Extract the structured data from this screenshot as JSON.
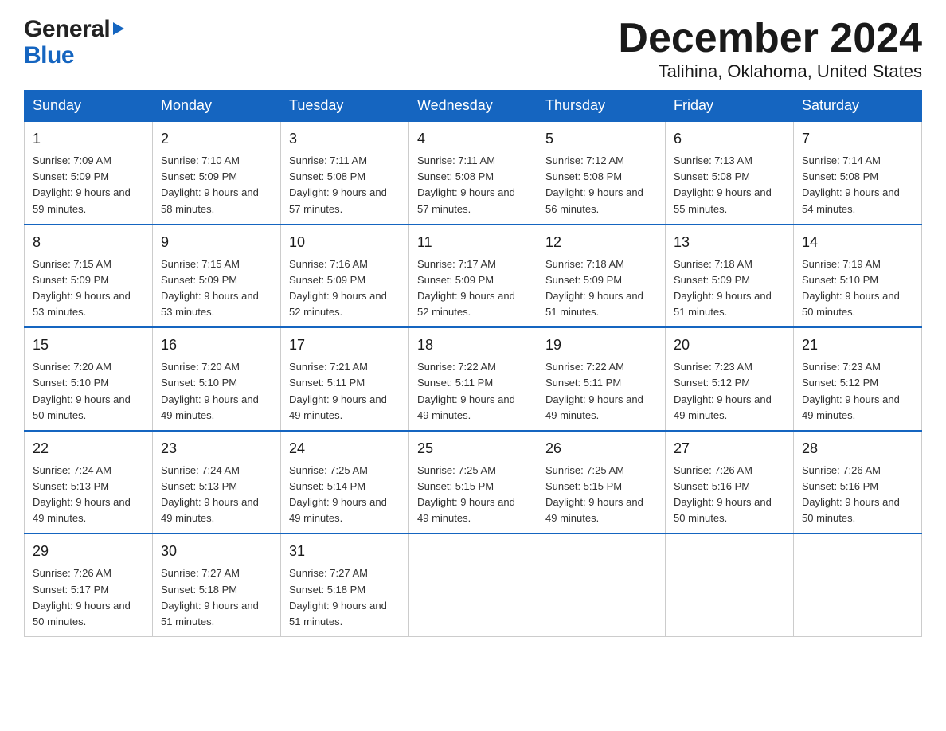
{
  "header": {
    "logo_general": "General",
    "logo_blue": "Blue",
    "month_title": "December 2024",
    "location": "Talihina, Oklahoma, United States"
  },
  "days_of_week": [
    "Sunday",
    "Monday",
    "Tuesday",
    "Wednesday",
    "Thursday",
    "Friday",
    "Saturday"
  ],
  "weeks": [
    [
      {
        "day": "1",
        "sunrise": "7:09 AM",
        "sunset": "5:09 PM",
        "daylight": "9 hours and 59 minutes."
      },
      {
        "day": "2",
        "sunrise": "7:10 AM",
        "sunset": "5:09 PM",
        "daylight": "9 hours and 58 minutes."
      },
      {
        "day": "3",
        "sunrise": "7:11 AM",
        "sunset": "5:08 PM",
        "daylight": "9 hours and 57 minutes."
      },
      {
        "day": "4",
        "sunrise": "7:11 AM",
        "sunset": "5:08 PM",
        "daylight": "9 hours and 57 minutes."
      },
      {
        "day": "5",
        "sunrise": "7:12 AM",
        "sunset": "5:08 PM",
        "daylight": "9 hours and 56 minutes."
      },
      {
        "day": "6",
        "sunrise": "7:13 AM",
        "sunset": "5:08 PM",
        "daylight": "9 hours and 55 minutes."
      },
      {
        "day": "7",
        "sunrise": "7:14 AM",
        "sunset": "5:08 PM",
        "daylight": "9 hours and 54 minutes."
      }
    ],
    [
      {
        "day": "8",
        "sunrise": "7:15 AM",
        "sunset": "5:09 PM",
        "daylight": "9 hours and 53 minutes."
      },
      {
        "day": "9",
        "sunrise": "7:15 AM",
        "sunset": "5:09 PM",
        "daylight": "9 hours and 53 minutes."
      },
      {
        "day": "10",
        "sunrise": "7:16 AM",
        "sunset": "5:09 PM",
        "daylight": "9 hours and 52 minutes."
      },
      {
        "day": "11",
        "sunrise": "7:17 AM",
        "sunset": "5:09 PM",
        "daylight": "9 hours and 52 minutes."
      },
      {
        "day": "12",
        "sunrise": "7:18 AM",
        "sunset": "5:09 PM",
        "daylight": "9 hours and 51 minutes."
      },
      {
        "day": "13",
        "sunrise": "7:18 AM",
        "sunset": "5:09 PM",
        "daylight": "9 hours and 51 minutes."
      },
      {
        "day": "14",
        "sunrise": "7:19 AM",
        "sunset": "5:10 PM",
        "daylight": "9 hours and 50 minutes."
      }
    ],
    [
      {
        "day": "15",
        "sunrise": "7:20 AM",
        "sunset": "5:10 PM",
        "daylight": "9 hours and 50 minutes."
      },
      {
        "day": "16",
        "sunrise": "7:20 AM",
        "sunset": "5:10 PM",
        "daylight": "9 hours and 49 minutes."
      },
      {
        "day": "17",
        "sunrise": "7:21 AM",
        "sunset": "5:11 PM",
        "daylight": "9 hours and 49 minutes."
      },
      {
        "day": "18",
        "sunrise": "7:22 AM",
        "sunset": "5:11 PM",
        "daylight": "9 hours and 49 minutes."
      },
      {
        "day": "19",
        "sunrise": "7:22 AM",
        "sunset": "5:11 PM",
        "daylight": "9 hours and 49 minutes."
      },
      {
        "day": "20",
        "sunrise": "7:23 AM",
        "sunset": "5:12 PM",
        "daylight": "9 hours and 49 minutes."
      },
      {
        "day": "21",
        "sunrise": "7:23 AM",
        "sunset": "5:12 PM",
        "daylight": "9 hours and 49 minutes."
      }
    ],
    [
      {
        "day": "22",
        "sunrise": "7:24 AM",
        "sunset": "5:13 PM",
        "daylight": "9 hours and 49 minutes."
      },
      {
        "day": "23",
        "sunrise": "7:24 AM",
        "sunset": "5:13 PM",
        "daylight": "9 hours and 49 minutes."
      },
      {
        "day": "24",
        "sunrise": "7:25 AM",
        "sunset": "5:14 PM",
        "daylight": "9 hours and 49 minutes."
      },
      {
        "day": "25",
        "sunrise": "7:25 AM",
        "sunset": "5:15 PM",
        "daylight": "9 hours and 49 minutes."
      },
      {
        "day": "26",
        "sunrise": "7:25 AM",
        "sunset": "5:15 PM",
        "daylight": "9 hours and 49 minutes."
      },
      {
        "day": "27",
        "sunrise": "7:26 AM",
        "sunset": "5:16 PM",
        "daylight": "9 hours and 50 minutes."
      },
      {
        "day": "28",
        "sunrise": "7:26 AM",
        "sunset": "5:16 PM",
        "daylight": "9 hours and 50 minutes."
      }
    ],
    [
      {
        "day": "29",
        "sunrise": "7:26 AM",
        "sunset": "5:17 PM",
        "daylight": "9 hours and 50 minutes."
      },
      {
        "day": "30",
        "sunrise": "7:27 AM",
        "sunset": "5:18 PM",
        "daylight": "9 hours and 51 minutes."
      },
      {
        "day": "31",
        "sunrise": "7:27 AM",
        "sunset": "5:18 PM",
        "daylight": "9 hours and 51 minutes."
      },
      null,
      null,
      null,
      null
    ]
  ]
}
